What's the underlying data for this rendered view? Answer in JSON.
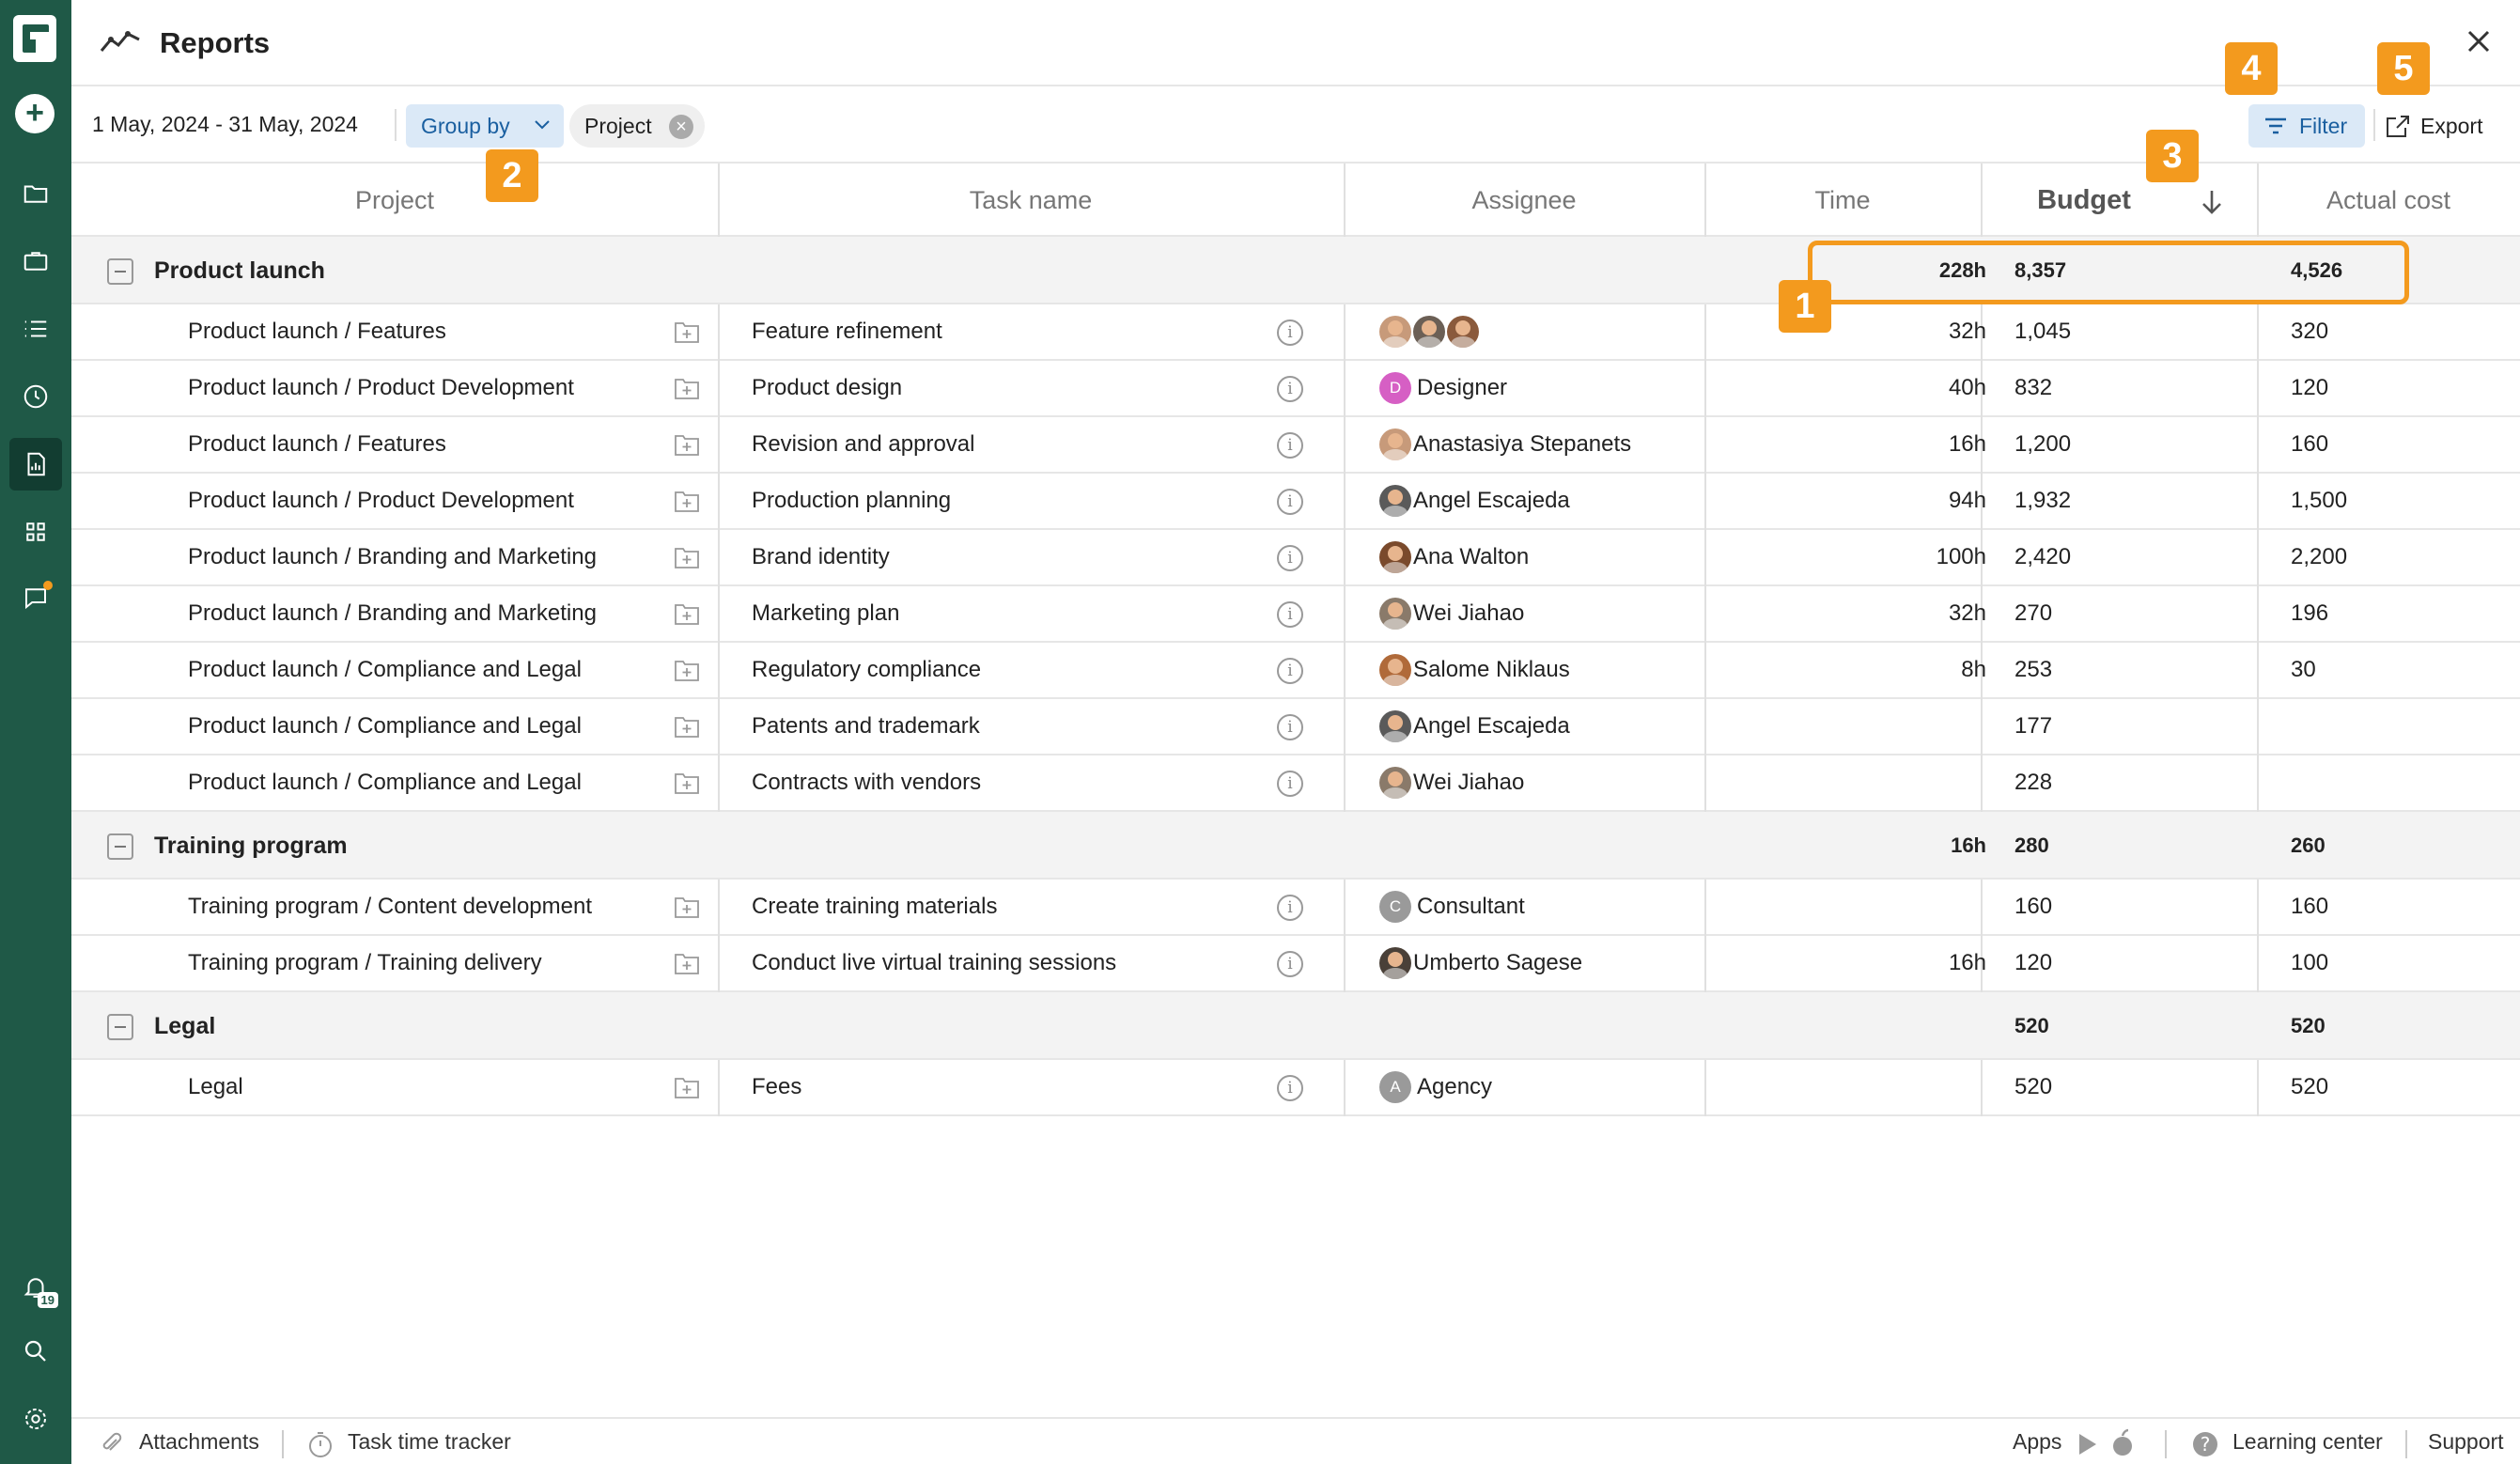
{
  "header": {
    "title": "Reports"
  },
  "toolbar": {
    "date_range": "1 May, 2024 - 31 May, 2024",
    "group_by_label": "Group by",
    "chip_label": "Project",
    "filter_label": "Filter",
    "export_label": "Export"
  },
  "columns": {
    "project": "Project",
    "task": "Task name",
    "assignee": "Assignee",
    "time": "Time",
    "budget": "Budget",
    "actual": "Actual cost"
  },
  "groups": [
    {
      "name": "Product launch",
      "time": "228h",
      "budget": "8,357",
      "actual": "4,526",
      "rows": [
        {
          "project": "Product launch / Features",
          "task": "Feature refinement",
          "assignee": "",
          "avatars": [
            "#c79a7a",
            "#6b5f55",
            "#8a5a3c"
          ],
          "time": "32h",
          "budget": "1,045",
          "actual": "320"
        },
        {
          "project": "Product launch / Product Development",
          "task": "Product design",
          "assignee": "Designer",
          "letter": "D",
          "letter_color": "#d65fc4",
          "time": "40h",
          "budget": "832",
          "actual": "120"
        },
        {
          "project": "Product launch / Features",
          "task": "Revision and approval",
          "assignee": "Anastasiya Stepanets",
          "avatars": [
            "#c79a7a"
          ],
          "time": "16h",
          "budget": "1,200",
          "actual": "160"
        },
        {
          "project": "Product launch / Product Development",
          "task": "Production planning",
          "assignee": "Angel Escajeda",
          "avatars": [
            "#5a5a5a"
          ],
          "time": "94h",
          "budget": "1,932",
          "actual": "1,500"
        },
        {
          "project": "Product launch / Branding and Marketing",
          "task": "Brand identity",
          "assignee": "Ana Walton",
          "avatars": [
            "#7a4a2c"
          ],
          "time": "100h",
          "budget": "2,420",
          "actual": "2,200"
        },
        {
          "project": "Product launch / Branding and Marketing",
          "task": "Marketing plan",
          "assignee": "Wei Jiahao",
          "avatars": [
            "#8a7a6a"
          ],
          "time": "32h",
          "budget": "270",
          "actual": "196"
        },
        {
          "project": "Product launch / Compliance and Legal",
          "task": "Regulatory compliance",
          "assignee": "Salome Niklaus",
          "avatars": [
            "#b06a3a"
          ],
          "time": "8h",
          "budget": "253",
          "actual": "30"
        },
        {
          "project": "Product launch / Compliance and Legal",
          "task": "Patents and trademark",
          "assignee": "Angel Escajeda",
          "avatars": [
            "#5a5a5a"
          ],
          "time": "",
          "budget": "177",
          "actual": ""
        },
        {
          "project": "Product launch / Compliance and Legal",
          "task": "Contracts with vendors",
          "assignee": "Wei Jiahao",
          "avatars": [
            "#8a7a6a"
          ],
          "time": "",
          "budget": "228",
          "actual": ""
        }
      ]
    },
    {
      "name": "Training program",
      "time": "16h",
      "budget": "280",
      "actual": "260",
      "rows": [
        {
          "project": "Training program / Content development",
          "task": "Create training materials",
          "assignee": "Consultant",
          "letter": "C",
          "letter_color": "#9a9a9a",
          "time": "",
          "budget": "160",
          "actual": "160"
        },
        {
          "project": "Training program / Training delivery",
          "task": "Conduct live virtual training sessions",
          "assignee": "Umberto Sagese",
          "avatars": [
            "#4a4038"
          ],
          "time": "16h",
          "budget": "120",
          "actual": "100"
        }
      ]
    },
    {
      "name": "Legal",
      "time": "",
      "budget": "520",
      "actual": "520",
      "rows": [
        {
          "project": "Legal",
          "task": "Fees",
          "assignee": "Agency",
          "letter": "A",
          "letter_color": "#9a9a9a",
          "time": "",
          "budget": "520",
          "actual": "520"
        }
      ]
    }
  ],
  "annotations": [
    "1",
    "2",
    "3",
    "4",
    "5"
  ],
  "footer": {
    "attachments": "Attachments",
    "time_tracker": "Task time tracker",
    "apps": "Apps",
    "learning": "Learning center",
    "support": "Support"
  },
  "sidebar": {
    "notification_count": "19"
  },
  "colors": {
    "sidebar": "#1f5947",
    "accent": "#f39a1e",
    "button_bg": "#dbe9f7",
    "button_text": "#1a5fa0"
  }
}
